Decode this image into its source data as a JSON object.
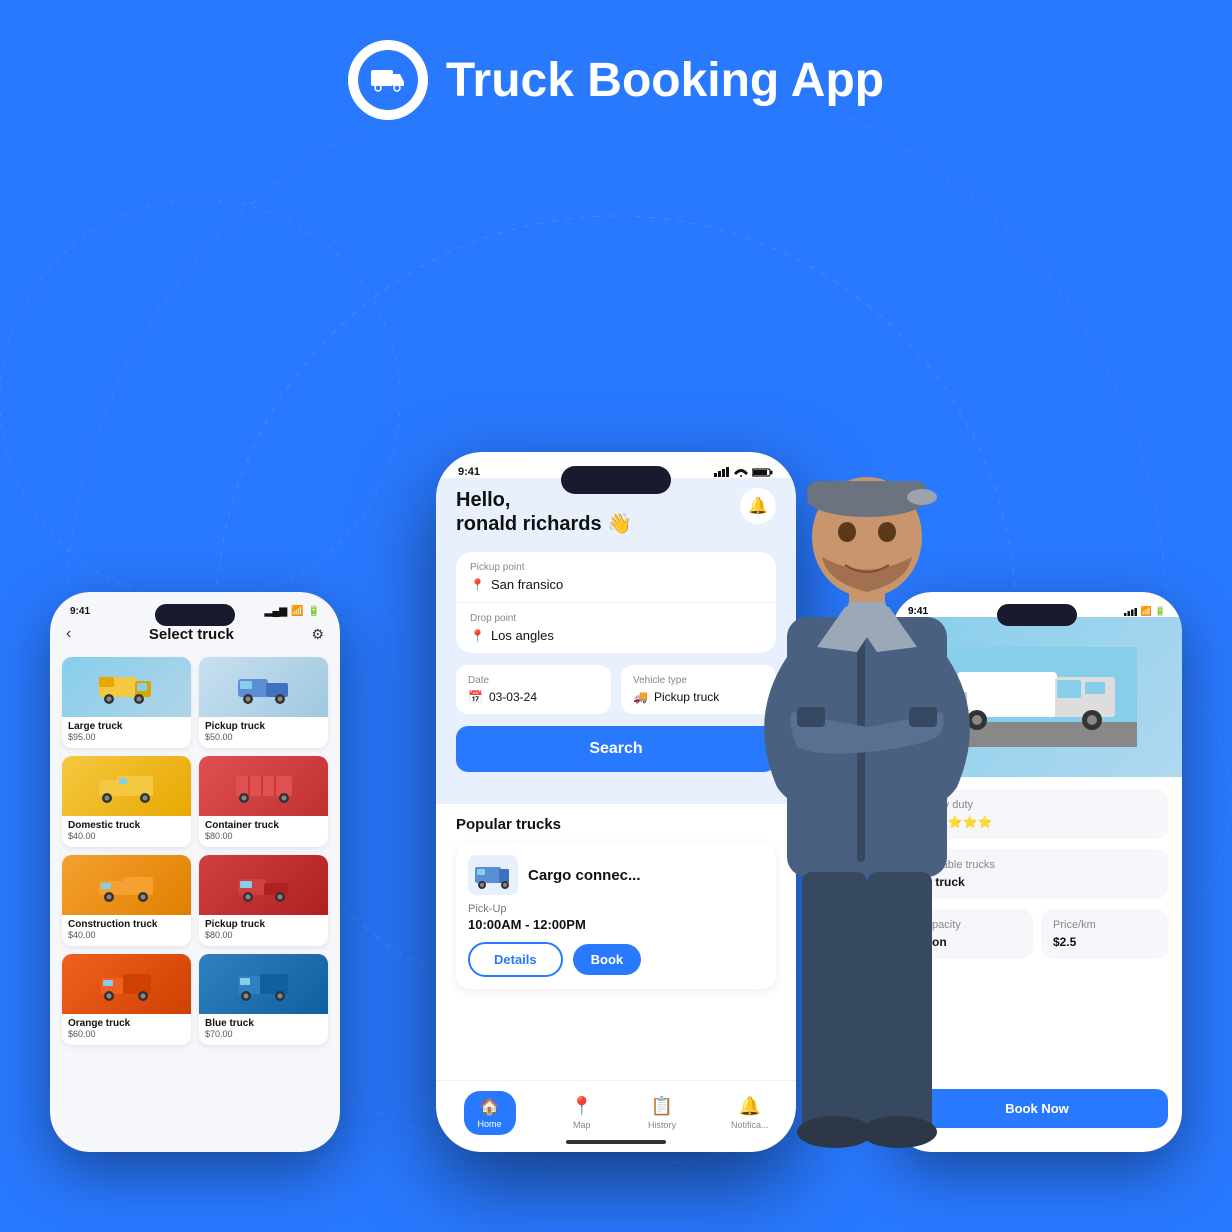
{
  "app": {
    "title": "Truck Booking App"
  },
  "header": {
    "logo_alt": "truck-logo"
  },
  "left_phone": {
    "status_time": "9:41",
    "screen_title": "Select truck",
    "trucks": [
      {
        "name": "Large truck",
        "price": "$95.00",
        "img_type": "large",
        "emoji": "🚛"
      },
      {
        "name": "Pickup truck",
        "price": "$50.00",
        "img_type": "pickup",
        "emoji": "🚚"
      },
      {
        "name": "Domestic truck",
        "price": "$40.00",
        "img_type": "domestic",
        "emoji": "🚛"
      },
      {
        "name": "Container truck",
        "price": "$80.00",
        "img_type": "container",
        "emoji": "🚢"
      },
      {
        "name": "Construction truck",
        "price": "$40.00",
        "img_type": "construction",
        "emoji": "🚜"
      },
      {
        "name": "Pickup truck",
        "price": "$80.00",
        "img_type": "pickup2",
        "emoji": "🚗"
      },
      {
        "name": "Orange truck",
        "price": "$60.00",
        "img_type": "orange",
        "emoji": "🚛"
      },
      {
        "name": "Blue truck",
        "price": "$70.00",
        "img_type": "blue",
        "emoji": "🚚"
      }
    ]
  },
  "center_phone": {
    "status_time": "9:41",
    "greeting_line1": "Hello,",
    "greeting_line2": "ronald richards 👋",
    "pickup_label": "Pickup point",
    "pickup_value": "San fransico",
    "drop_label": "Drop point",
    "drop_value": "Los angles",
    "date_label": "Date",
    "date_value": "03-03-24",
    "vehicle_label": "Vehicle type",
    "vehicle_value": "Pickup truck",
    "search_btn": "Search",
    "popular_title": "Popular trucks",
    "truck_name": "Cargo connec...",
    "pickup_time_label": "Pick-Up",
    "pickup_time_value": "10:00AM - 12:00PM",
    "details_btn": "Details",
    "nav": {
      "home": "Home",
      "map": "Map",
      "history": "History",
      "notifications": "Notifica..."
    }
  },
  "right_phone": {
    "status_time": "9:41",
    "truck_type_label": "Heavy duty",
    "truck_label": "...t truck",
    "book_btn": "Book Now"
  },
  "colors": {
    "primary": "#2979FF",
    "background": "#2979FF",
    "white": "#ffffff",
    "dark": "#111111",
    "gray": "#888888",
    "light_blue": "#e8f0fe"
  }
}
